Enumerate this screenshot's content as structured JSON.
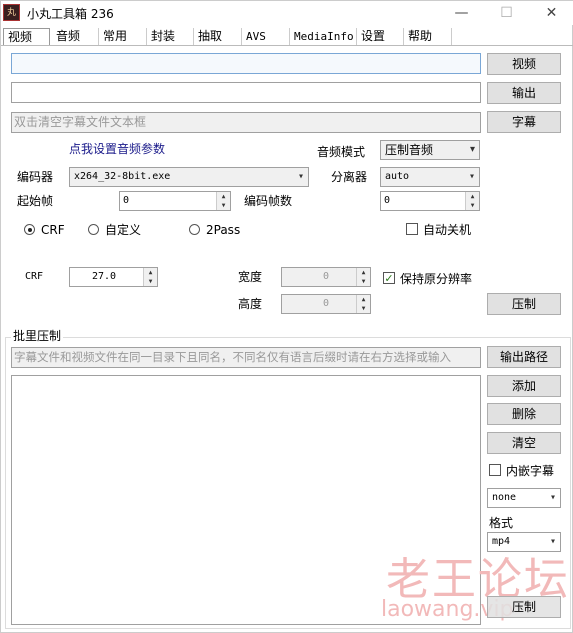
{
  "window": {
    "title": "小丸工具箱 236",
    "icon_text": "丸",
    "minimize": "—",
    "maximize": "☐",
    "close": "✕"
  },
  "tabs": [
    "视频",
    "音频",
    "常用",
    "封装",
    "抽取",
    "AVS",
    "MediaInfo",
    "设置",
    "帮助"
  ],
  "files": {
    "video_btn": "视频",
    "output_btn": "输出",
    "subtitle_btn": "字幕",
    "subtitle_placeholder": "双击清空字幕文件文本框"
  },
  "audio": {
    "set_params_link": "点我设置音频参数",
    "mode_label": "音频模式",
    "mode_value": "压制音频"
  },
  "encoder": {
    "label": "编码器",
    "value": "x264_32-8bit.exe"
  },
  "splitter": {
    "label": "分离器",
    "value": "auto"
  },
  "start_frame": {
    "label": "起始帧",
    "value": "0"
  },
  "frame_count": {
    "label": "编码帧数",
    "value": "0"
  },
  "modes": {
    "crf": "CRF",
    "custom": "自定义",
    "twopass": "2Pass",
    "selected": "crf"
  },
  "auto_shutdown": {
    "label": "自动关机",
    "checked": false
  },
  "crf": {
    "label": "CRF",
    "value": "27.0"
  },
  "width": {
    "label": "宽度",
    "value": "0"
  },
  "height": {
    "label": "高度",
    "value": "0"
  },
  "keep_resolution": {
    "label": "保持原分辨率",
    "checked": true,
    "mark": "✓"
  },
  "compress_btn": "压制",
  "batch": {
    "title": "批里压制",
    "hint": "字幕文件和视频文件在同一目录下且同名，不同名仅有语言后缀时请在右方选择或输入",
    "output_path_btn": "输出路径",
    "add_btn": "添加",
    "delete_btn": "删除",
    "clear_btn": "清空",
    "embed_sub_label": "内嵌字幕",
    "embed_sub_checked": false,
    "lang_value": "none",
    "format_label": "格式",
    "format_value": "mp4",
    "compress_btn": "压制"
  },
  "watermark": {
    "cn": "老王论坛",
    "url": "laowang.vip"
  }
}
